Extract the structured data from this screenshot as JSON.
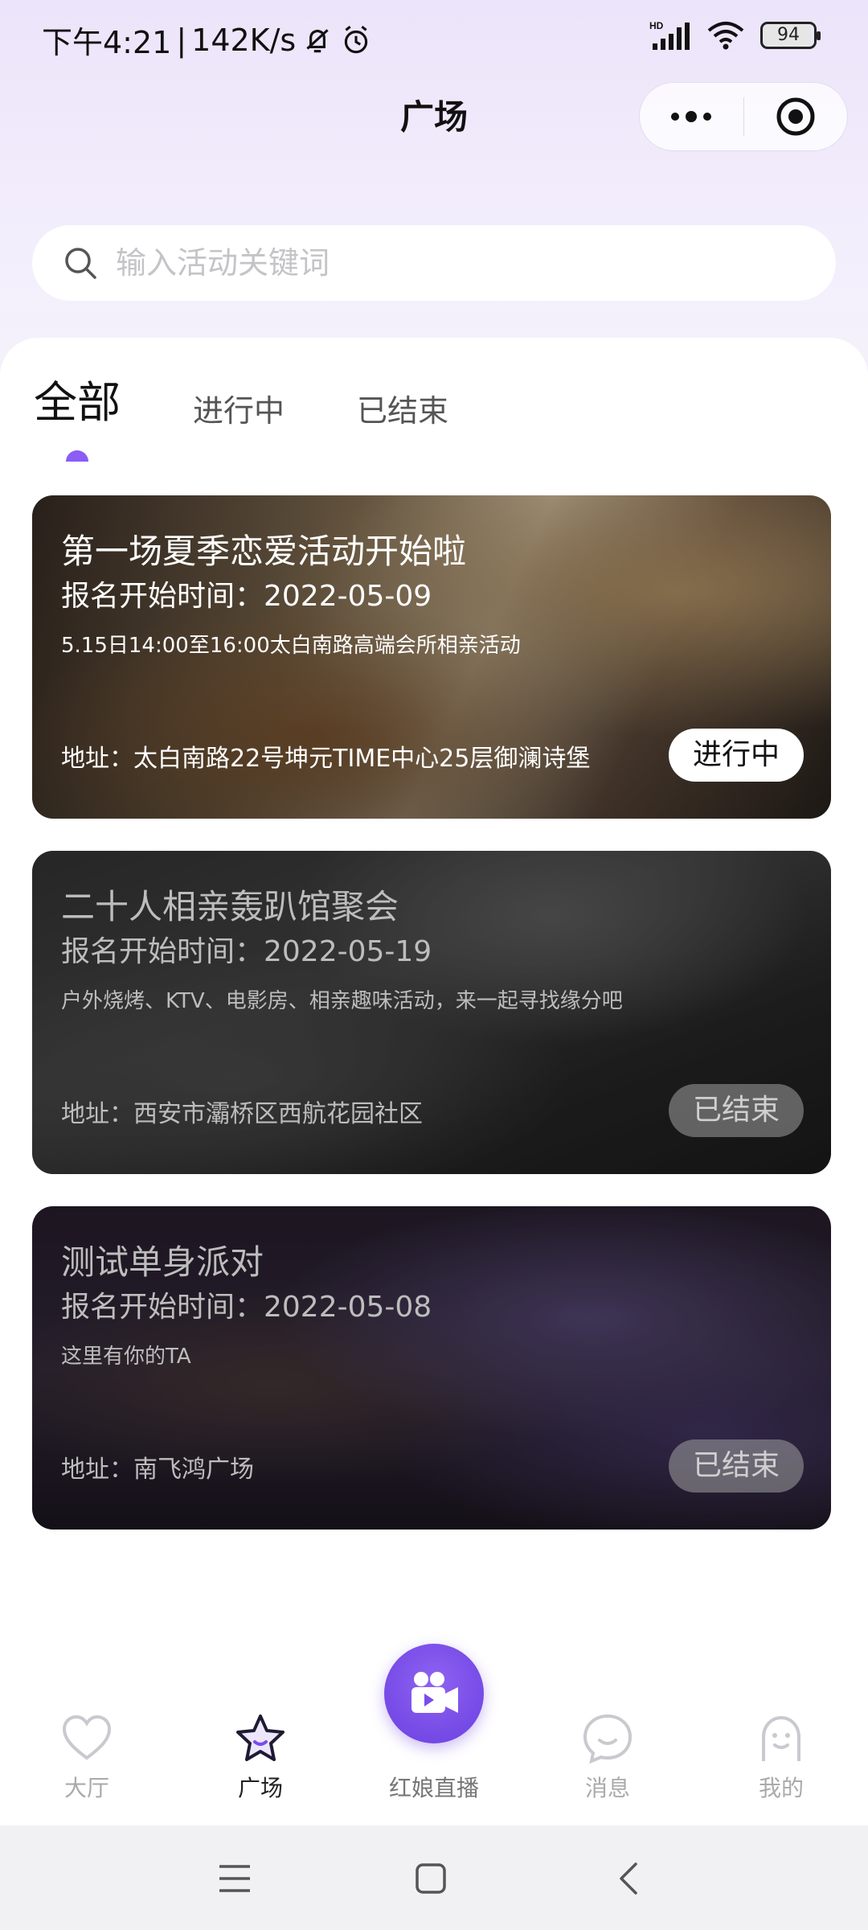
{
  "status_bar": {
    "time": "下午4:21",
    "separator": "|",
    "network_speed": "142K/s",
    "battery": "94",
    "hd_label": "HD",
    "icons": [
      "mute-icon",
      "alarm-icon",
      "signal-icon",
      "wifi-icon",
      "battery-icon"
    ]
  },
  "header": {
    "title": "广场",
    "capsule_icons": [
      "more-dots-icon",
      "target-circle-icon"
    ]
  },
  "search": {
    "placeholder": "输入活动关键词",
    "value": ""
  },
  "tabs": [
    {
      "label": "全部",
      "active": true
    },
    {
      "label": "进行中",
      "active": false
    },
    {
      "label": "已结束",
      "active": false
    }
  ],
  "activities": [
    {
      "title": "第一场夏季恋爱活动开始啦",
      "start_time": "报名开始时间：2022-05-09",
      "description": "5.15日14:00至16:00太白南路高端会所相亲活动",
      "address": "地址：太白南路22号坤元TIME中心25层御澜诗堡",
      "status": "进行中"
    },
    {
      "title": "二十人相亲轰趴馆聚会",
      "start_time": "报名开始时间：2022-05-19",
      "description": "户外烧烤、KTV、电影房、相亲趣味活动，来一起寻找缘分吧",
      "address": "地址：西安市灞桥区西航花园社区",
      "status": "已结束"
    },
    {
      "title": "测试单身派对",
      "start_time": "报名开始时间：2022-05-08",
      "description": "这里有你的TA",
      "address": "地址：南飞鸿广场",
      "status": "已结束"
    }
  ],
  "bottom_nav": {
    "items": [
      {
        "label": "大厅",
        "icon": "heart-icon",
        "active": false
      },
      {
        "label": "广场",
        "icon": "star-icon",
        "active": true
      },
      {
        "label": "红娘直播",
        "icon": "video-camera-icon",
        "active": false
      },
      {
        "label": "消息",
        "icon": "chat-bubble-icon",
        "active": false
      },
      {
        "label": "我的",
        "icon": "profile-icon",
        "active": false
      }
    ]
  },
  "colors": {
    "accent": "#8b5cf6",
    "live_button": "#7a4cec",
    "panel": "#ffffff"
  }
}
